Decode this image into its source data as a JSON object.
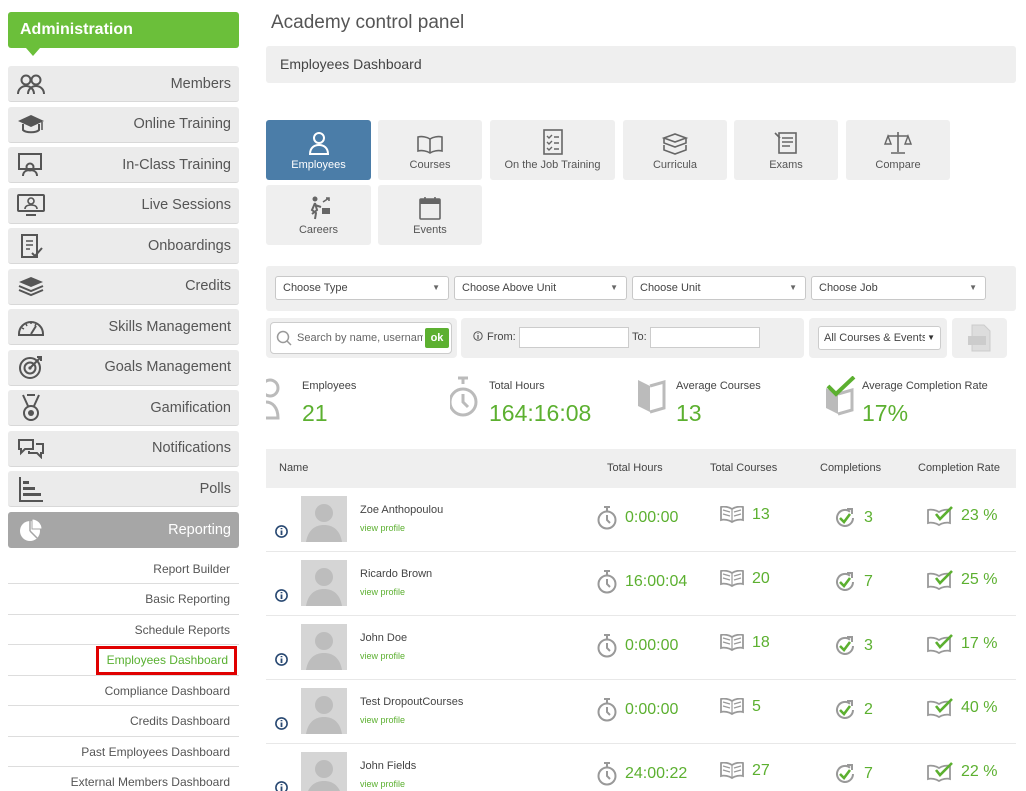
{
  "sidebar": {
    "header": "Administration",
    "items": [
      {
        "label": "Members",
        "icon": "members-icon"
      },
      {
        "label": "Online Training",
        "icon": "graduation-cap-icon"
      },
      {
        "label": "In-Class Training",
        "icon": "classroom-icon"
      },
      {
        "label": "Live Sessions",
        "icon": "monitor-user-icon"
      },
      {
        "label": "Onboardings",
        "icon": "checklist-icon"
      },
      {
        "label": "Credits",
        "icon": "stack-icon"
      },
      {
        "label": "Skills Management",
        "icon": "gauge-icon"
      },
      {
        "label": "Goals Management",
        "icon": "target-icon"
      },
      {
        "label": "Gamification",
        "icon": "medal-icon"
      },
      {
        "label": "Notifications",
        "icon": "chat-icon"
      },
      {
        "label": "Polls",
        "icon": "bar-chart-icon"
      },
      {
        "label": "Reporting",
        "icon": "pie-chart-icon"
      }
    ],
    "subitems": [
      "Report Builder",
      "Basic Reporting",
      "Schedule Reports",
      "Employees Dashboard",
      "Compliance Dashboard",
      "Credits Dashboard",
      "Past Employees Dashboard",
      "External Members Dashboard"
    ]
  },
  "main": {
    "title": "Academy control panel",
    "breadcrumb": "Employees Dashboard",
    "tabs": [
      "Employees",
      "Courses",
      "On the Job Training",
      "Curricula",
      "Exams",
      "Compare",
      "Careers",
      "Events"
    ],
    "filters": [
      "Choose Type",
      "Choose Above Unit",
      "Choose Unit",
      "Choose Job"
    ],
    "search": {
      "placeholder": "Search by name, username",
      "ok": "ok"
    },
    "date": {
      "from": "From:",
      "to": "To:"
    },
    "courses_select": "All Courses & Events",
    "stats": {
      "employees_label": "Employees",
      "employees_value": "21",
      "hours_label": "Total Hours",
      "hours_value": "164:16:08",
      "courses_label": "Average Courses",
      "courses_value": "13",
      "rate_label": "Average Completion Rate",
      "rate_value": "17%"
    },
    "table": {
      "headers": [
        "Name",
        "Total Hours",
        "Total Courses",
        "Completions",
        "Completion Rate"
      ],
      "view_profile": "view profile",
      "rows": [
        {
          "name": "Zoe Anthopoulou",
          "hours": "0:00:00",
          "courses": "13",
          "completions": "3",
          "rate": "23 %"
        },
        {
          "name": "Ricardo Brown",
          "hours": "16:00:04",
          "courses": "20",
          "completions": "7",
          "rate": "25 %"
        },
        {
          "name": "John Doe",
          "hours": "0:00:00",
          "courses": "18",
          "completions": "3",
          "rate": "17 %"
        },
        {
          "name": "Test DropoutCourses",
          "hours": "0:00:00",
          "courses": "5",
          "completions": "2",
          "rate": "40 %"
        },
        {
          "name": "John Fields",
          "hours": "24:00:22",
          "courses": "27",
          "completions": "7",
          "rate": "22 %"
        }
      ]
    }
  }
}
